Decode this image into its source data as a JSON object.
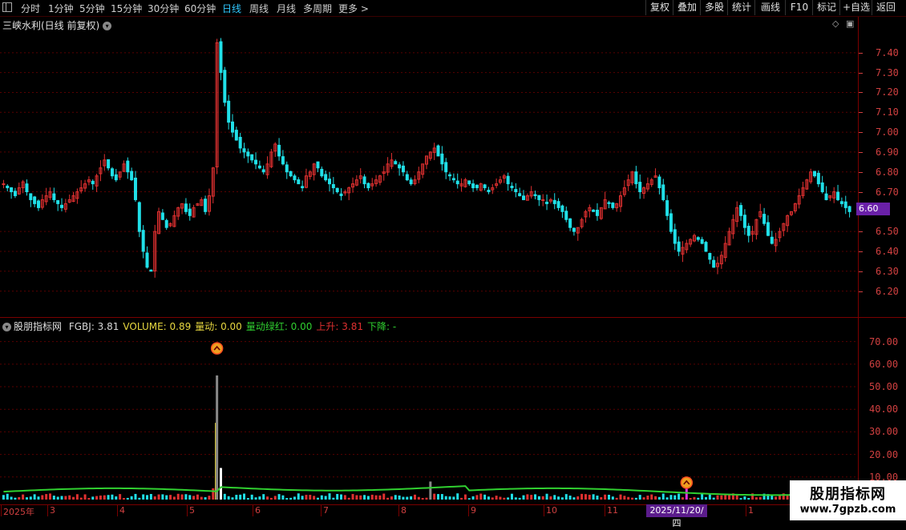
{
  "toolbar": {
    "periods": [
      "分时",
      "1分钟",
      "5分钟",
      "15分钟",
      "30分钟",
      "60分钟",
      "日线",
      "周线",
      "月线",
      "多周期",
      "更多 >"
    ],
    "active_period": "日线",
    "right_buttons": [
      "复权",
      "叠加",
      "多股",
      "统计",
      "画线",
      "F10",
      "标记",
      "+自选",
      "返回"
    ]
  },
  "chart": {
    "title": "三峡水利(日线 前复权)",
    "current_price": "6.60",
    "price_axis": [
      "7.40",
      "7.30",
      "7.20",
      "7.10",
      "7.00",
      "6.90",
      "6.80",
      "6.70",
      "6.50",
      "6.40",
      "6.30",
      "6.20"
    ]
  },
  "indicator": {
    "name": "股朋指标网",
    "items": [
      {
        "text": "FGBJ: 3.81",
        "color": "#d8d8d8"
      },
      {
        "text": "VOLUME: 0.89",
        "color": "#e8d840"
      },
      {
        "text": "量动: 0.00",
        "color": "#e8d840"
      },
      {
        "text": "量动绿红: 0.00",
        "color": "#30d030"
      },
      {
        "text": "上升: 3.81",
        "color": "#e03030"
      },
      {
        "text": "下降: -",
        "color": "#30d030"
      }
    ],
    "axis": [
      "70.00",
      "60.00",
      "50.00",
      "40.00",
      "30.00",
      "20.00",
      "10.00"
    ]
  },
  "dates": {
    "labels": [
      "2025年",
      "3",
      "4",
      "5",
      "6",
      "7",
      "8",
      "9",
      "10",
      "11",
      "1"
    ],
    "highlight": "2025/11/20/四"
  },
  "watermark": {
    "line1": "股朋指标网",
    "line2": "www.7gpzb.com"
  },
  "colors": {
    "up": "#e03030",
    "down": "#20e0e8",
    "grid": "#7a0000",
    "accent": "#30c8ff"
  },
  "chart_data": {
    "type": "candlestick",
    "ylim": [
      6.15,
      7.5
    ],
    "close_series": [
      6.74,
      6.72,
      6.7,
      6.68,
      6.72,
      6.75,
      6.7,
      6.66,
      6.64,
      6.62,
      6.66,
      6.68,
      6.7,
      6.66,
      6.64,
      6.62,
      6.64,
      6.66,
      6.68,
      6.7,
      6.72,
      6.74,
      6.76,
      6.74,
      6.78,
      6.82,
      6.86,
      6.82,
      6.78,
      6.76,
      6.8,
      6.84,
      6.8,
      6.76,
      6.66,
      6.5,
      6.4,
      6.32,
      6.3,
      6.5,
      6.6,
      6.56,
      6.52,
      6.54,
      6.58,
      6.62,
      6.64,
      6.6,
      6.58,
      6.62,
      6.64,
      6.66,
      6.6,
      6.68,
      6.82,
      7.45,
      7.3,
      7.15,
      7.05,
      7.0,
      6.96,
      6.92,
      6.9,
      6.88,
      6.86,
      6.84,
      6.82,
      6.8,
      6.84,
      6.9,
      6.94,
      6.88,
      6.84,
      6.8,
      6.78,
      6.76,
      6.74,
      6.72,
      6.78,
      6.8,
      6.84,
      6.82,
      6.78,
      6.76,
      6.74,
      6.72,
      6.7,
      6.68,
      6.7,
      6.72,
      6.74,
      6.76,
      6.78,
      6.74,
      6.72,
      6.74,
      6.76,
      6.78,
      6.8,
      6.84,
      6.86,
      6.84,
      6.82,
      6.8,
      6.76,
      6.74,
      6.76,
      6.8,
      6.84,
      6.88,
      6.9,
      6.92,
      6.88,
      6.84,
      6.8,
      6.78,
      6.76,
      6.74,
      6.74,
      6.76,
      6.74,
      6.72,
      6.72,
      6.74,
      6.72,
      6.7,
      6.72,
      6.74,
      6.76,
      6.78,
      6.74,
      6.72,
      6.7,
      6.68,
      6.66,
      6.68,
      6.7,
      6.68,
      6.66,
      6.66,
      6.64,
      6.66,
      6.64,
      6.62,
      6.6,
      6.56,
      6.52,
      6.5,
      6.52,
      6.56,
      6.6,
      6.62,
      6.6,
      6.58,
      6.62,
      6.66,
      6.64,
      6.62,
      6.64,
      6.68,
      6.72,
      6.76,
      6.8,
      6.74,
      6.7,
      6.72,
      6.74,
      6.76,
      6.78,
      6.72,
      6.66,
      6.58,
      6.5,
      6.44,
      6.4,
      6.42,
      6.44,
      6.46,
      6.48,
      6.46,
      6.44,
      6.4,
      6.36,
      6.32,
      6.34,
      6.38,
      6.44,
      6.5,
      6.56,
      6.62,
      6.58,
      6.52,
      6.48,
      6.5,
      6.56,
      6.6,
      6.54,
      6.48,
      6.44,
      6.46,
      6.5,
      6.54,
      6.58,
      6.6,
      6.64,
      6.68,
      6.72,
      6.76,
      6.8,
      6.78,
      6.74,
      6.7,
      6.66,
      6.68,
      6.7,
      6.66,
      6.64,
      6.62,
      6.6
    ]
  }
}
